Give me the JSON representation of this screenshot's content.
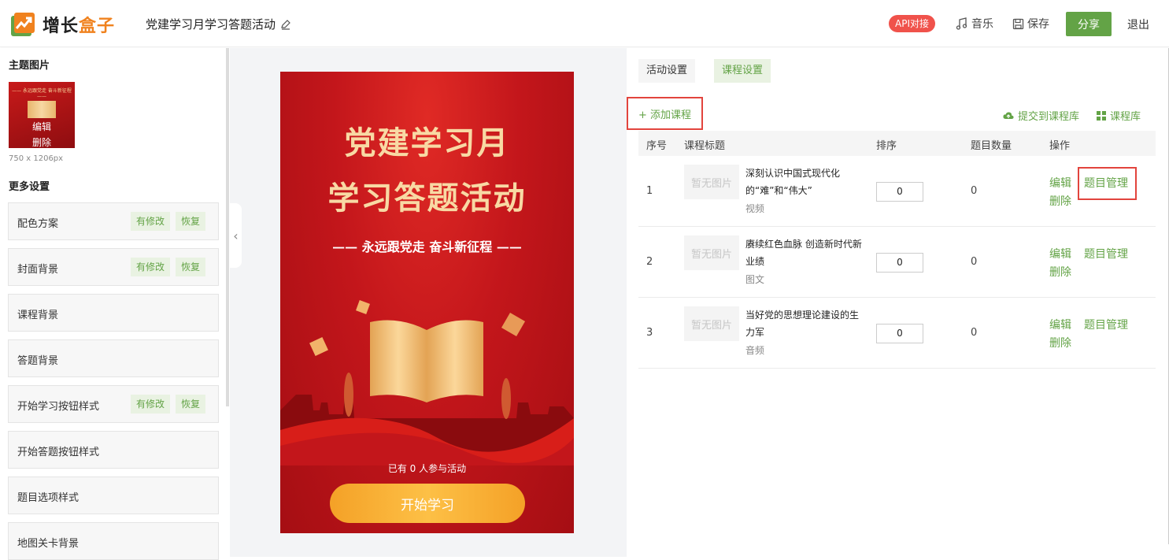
{
  "header": {
    "logo_part1": "增长",
    "logo_part2": "盒子",
    "doc_title": "党建学习月学习答题活动",
    "api_badge": "API对接",
    "music": "音乐",
    "save": "保存",
    "share": "分享",
    "logout": "退出"
  },
  "left": {
    "theme_title": "主题图片",
    "thumb_edit": "编辑",
    "thumb_delete": "删除",
    "thumb_dims": "750 x 1206px",
    "more_title": "更多设置",
    "items": [
      {
        "label": "配色方案",
        "modified": "有修改",
        "restore": "恢复"
      },
      {
        "label": "封面背景",
        "modified": "有修改",
        "restore": "恢复"
      },
      {
        "label": "课程背景"
      },
      {
        "label": "答题背景"
      },
      {
        "label": "开始学习按钮样式",
        "modified": "有修改",
        "restore": "恢复"
      },
      {
        "label": "开始答题按钮样式"
      },
      {
        "label": "题目选项样式"
      },
      {
        "label": "地图关卡背景"
      }
    ]
  },
  "poster": {
    "title_line1": "党建学习月",
    "title_line2": "学习答题活动",
    "subtitle": "—— 永远跟党走 奋斗新征程 ——",
    "participants": "已有 0 人参与活动",
    "start_button": "开始学习"
  },
  "right": {
    "tabs": [
      "活动设置",
      "课程设置"
    ],
    "add_course": "+ 添加课程",
    "submit_library": "提交到课程库",
    "course_library": "课程库",
    "columns": [
      "序号",
      "课程标题",
      "排序",
      "题目数量",
      "操作"
    ],
    "no_image": "暂无图片",
    "edit": "编辑",
    "delete": "删除",
    "manage": "题目管理",
    "rows": [
      {
        "idx": "1",
        "title": "深刻认识中国式现代化的“难”和“伟大”",
        "type": "视频",
        "sort": "0",
        "count": "0"
      },
      {
        "idx": "2",
        "title": "赓续红色血脉 创造新时代新业绩",
        "type": "图文",
        "sort": "0",
        "count": "0"
      },
      {
        "idx": "3",
        "title": "当好党的思想理论建设的生力军",
        "type": "音频",
        "sort": "0",
        "count": "0"
      }
    ]
  },
  "colors": {
    "accent": "#63a346",
    "highlight": "#e2443d",
    "poster_red": "#c3161b"
  }
}
